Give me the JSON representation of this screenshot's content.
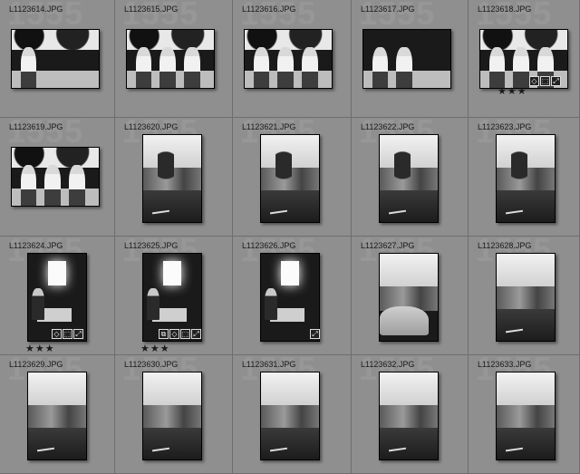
{
  "grid": {
    "ghost_label": "1555",
    "cells": [
      {
        "filename": "L1123614.JPG",
        "orientation": "land",
        "scene": "man-street",
        "stars": "",
        "badges": []
      },
      {
        "filename": "L1123615.JPG",
        "orientation": "land",
        "scene": "group",
        "stars": "",
        "badges": []
      },
      {
        "filename": "L1123616.JPG",
        "orientation": "land",
        "scene": "group",
        "stars": "",
        "badges": []
      },
      {
        "filename": "L1123617.JPG",
        "orientation": "land",
        "scene": "legs",
        "stars": "",
        "badges": []
      },
      {
        "filename": "L1123618.JPG",
        "orientation": "land",
        "scene": "group",
        "stars": "★★★",
        "badges": [
          "◇",
          "⬚",
          "⤢"
        ]
      },
      {
        "filename": "L1123619.JPG",
        "orientation": "land",
        "scene": "group",
        "stars": "",
        "badges": []
      },
      {
        "filename": "L1123620.JPG",
        "orientation": "port",
        "scene": "tree-street",
        "stars": "",
        "badges": []
      },
      {
        "filename": "L1123621.JPG",
        "orientation": "port",
        "scene": "tree-street",
        "stars": "",
        "badges": []
      },
      {
        "filename": "L1123622.JPG",
        "orientation": "port",
        "scene": "tree-street",
        "stars": "",
        "badges": []
      },
      {
        "filename": "L1123623.JPG",
        "orientation": "port",
        "scene": "tree-street",
        "stars": "",
        "badges": []
      },
      {
        "filename": "L1123624.JPG",
        "orientation": "port",
        "scene": "office",
        "stars": "★★★",
        "badges": [
          "◇",
          "⬚",
          "⤢"
        ]
      },
      {
        "filename": "L1123625.JPG",
        "orientation": "port",
        "scene": "office",
        "stars": "★★★",
        "badges": [
          "⧉",
          "◇",
          "⬚",
          "⤢"
        ]
      },
      {
        "filename": "L1123626.JPG",
        "orientation": "port",
        "scene": "office",
        "stars": "",
        "badges": [
          "⤢"
        ]
      },
      {
        "filename": "L1123627.JPG",
        "orientation": "port",
        "scene": "car",
        "stars": "",
        "badges": []
      },
      {
        "filename": "L1123628.JPG",
        "orientation": "port",
        "scene": "corner",
        "stars": "",
        "badges": []
      },
      {
        "filename": "L1123629.JPG",
        "orientation": "port",
        "scene": "corner",
        "stars": "",
        "badges": []
      },
      {
        "filename": "L1123630.JPG",
        "orientation": "port",
        "scene": "corner",
        "stars": "",
        "badges": []
      },
      {
        "filename": "L1123631.JPG",
        "orientation": "port",
        "scene": "corner",
        "stars": "",
        "badges": []
      },
      {
        "filename": "L1123632.JPG",
        "orientation": "port",
        "scene": "corner",
        "stars": "",
        "badges": []
      },
      {
        "filename": "L1123633.JPG",
        "orientation": "port",
        "scene": "corner",
        "stars": "",
        "badges": []
      }
    ]
  }
}
